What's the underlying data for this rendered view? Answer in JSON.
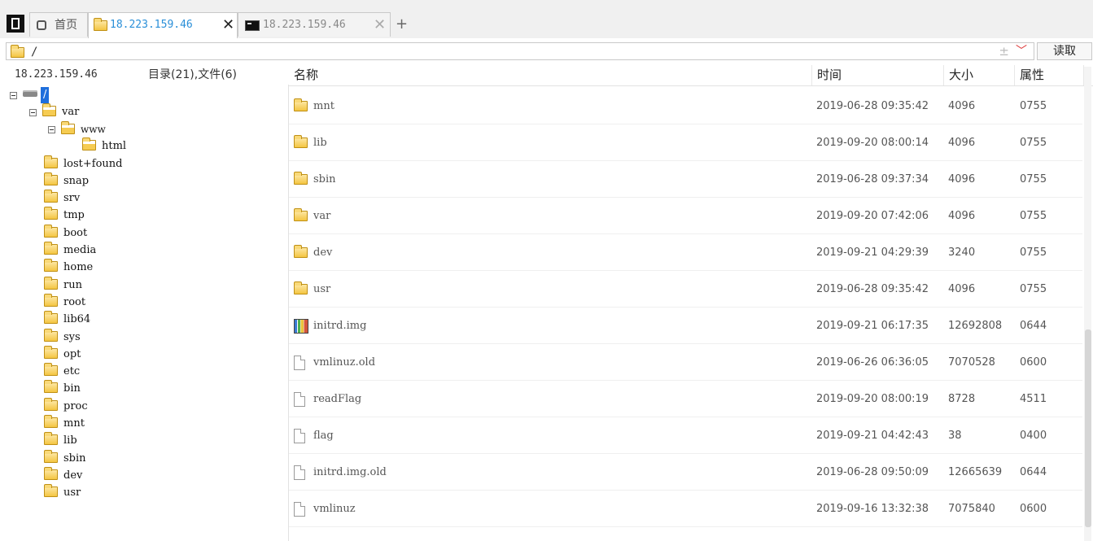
{
  "tabs": [
    {
      "label": "首页",
      "icon": "home-icon"
    },
    {
      "label": "18.223.159.46",
      "icon": "folder-icon",
      "active": true,
      "close": "✕"
    },
    {
      "label": "18.223.159.46",
      "icon": "terminal-icon",
      "close": "✕"
    }
  ],
  "tab_add": "+",
  "address": {
    "path": "/",
    "aux": "±",
    "dropdown": "﹀"
  },
  "read_button": "读取",
  "left_header": {
    "host": "18.223.159.46",
    "counts": "目录(21),文件(6)"
  },
  "tree": {
    "root": "/",
    "var": "var",
    "www": "www",
    "html": "html",
    "children": [
      "lost+found",
      "snap",
      "srv",
      "tmp",
      "boot",
      "media",
      "home",
      "run",
      "root",
      "lib64",
      "sys",
      "opt",
      "etc",
      "bin",
      "proc",
      "mnt",
      "lib",
      "sbin",
      "dev",
      "usr"
    ]
  },
  "columns": {
    "name": "名称",
    "time": "时间",
    "size": "大小",
    "attr": "属性"
  },
  "rows": [
    {
      "name": "mnt",
      "time": "2019-06-28 09:35:42",
      "size": "4096",
      "attr": "0755",
      "type": "folder"
    },
    {
      "name": "lib",
      "time": "2019-09-20 08:00:14",
      "size": "4096",
      "attr": "0755",
      "type": "folder"
    },
    {
      "name": "sbin",
      "time": "2019-06-28 09:37:34",
      "size": "4096",
      "attr": "0755",
      "type": "folder"
    },
    {
      "name": "var",
      "time": "2019-09-20 07:42:06",
      "size": "4096",
      "attr": "0755",
      "type": "folder"
    },
    {
      "name": "dev",
      "time": "2019-09-21 04:29:39",
      "size": "3240",
      "attr": "0755",
      "type": "folder"
    },
    {
      "name": "usr",
      "time": "2019-06-28 09:35:42",
      "size": "4096",
      "attr": "0755",
      "type": "folder"
    },
    {
      "name": "initrd.img",
      "time": "2019-09-21 06:17:35",
      "size": "12692808",
      "attr": "0644",
      "type": "archive"
    },
    {
      "name": "vmlinuz.old",
      "time": "2019-06-26 06:36:05",
      "size": "7070528",
      "attr": "0600",
      "type": "file"
    },
    {
      "name": "readFlag",
      "time": "2019-09-20 08:00:19",
      "size": "8728",
      "attr": "4511",
      "type": "file"
    },
    {
      "name": "flag",
      "time": "2019-09-21 04:42:43",
      "size": "38",
      "attr": "0400",
      "type": "file"
    },
    {
      "name": "initrd.img.old",
      "time": "2019-06-28 09:50:09",
      "size": "12665639",
      "attr": "0644",
      "type": "file"
    },
    {
      "name": "vmlinuz",
      "time": "2019-09-16 13:32:38",
      "size": "7075840",
      "attr": "0600",
      "type": "file"
    }
  ],
  "colors": {
    "accent": "#1f6fdc",
    "tab_active_text": "#2a8fd8",
    "folder": "#f4c542"
  }
}
